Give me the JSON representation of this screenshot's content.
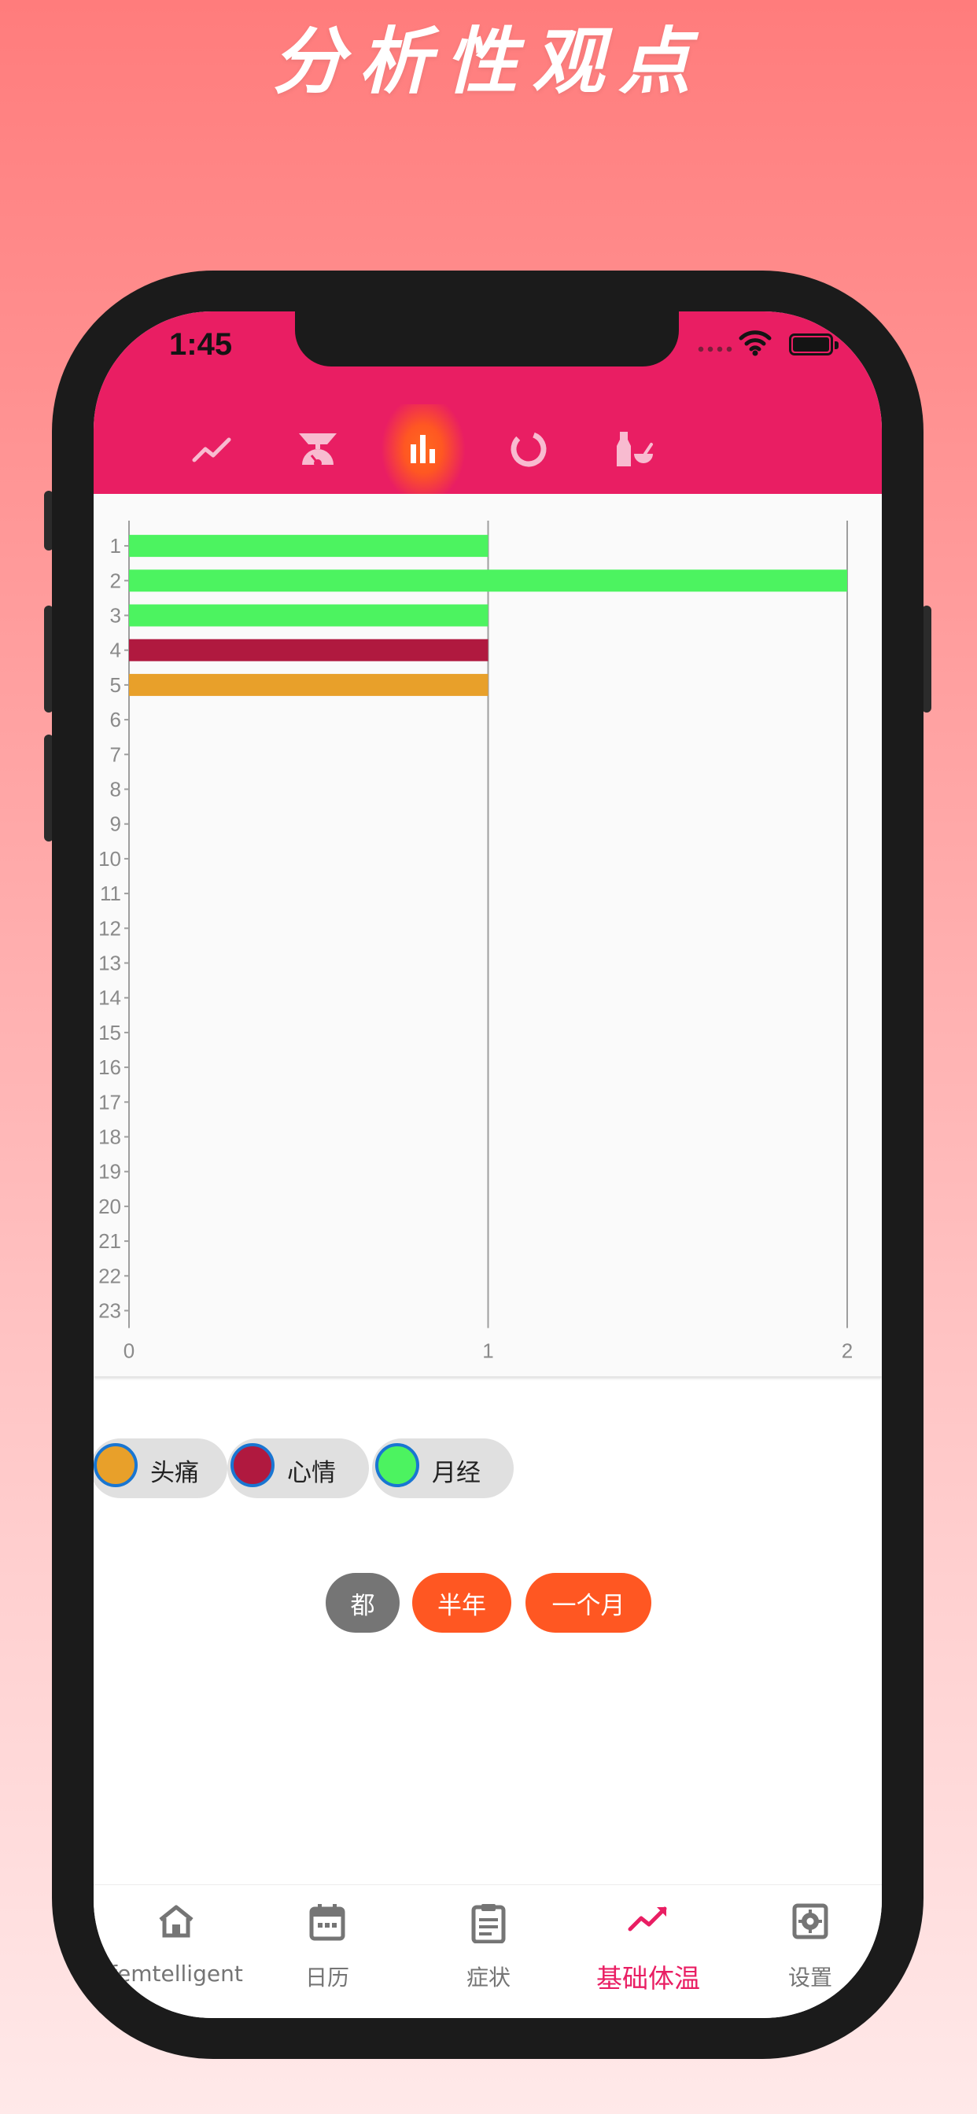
{
  "banner": {
    "title": "分析性观点"
  },
  "status_bar": {
    "time": "1:45"
  },
  "colors": {
    "primary": "#e91e63",
    "accent": "#ff5722",
    "headache": "#e8a02a",
    "mood": "#b0193f",
    "period": "#4cf360",
    "chip_bg": "#e0e0e0",
    "all_button": "#757575"
  },
  "top_tabs": [
    {
      "name": "tab-line-chart",
      "icon": "trending-up-icon",
      "active": false
    },
    {
      "name": "tab-scale",
      "icon": "scale-icon",
      "active": false
    },
    {
      "name": "tab-bar-chart",
      "icon": "bar-chart-icon",
      "active": true
    },
    {
      "name": "tab-donut",
      "icon": "donut-icon",
      "active": false
    },
    {
      "name": "tab-lab",
      "icon": "mortar-bottle-icon",
      "active": false
    }
  ],
  "chart_data": {
    "type": "bar",
    "orientation": "horizontal",
    "categories": [
      "1",
      "2",
      "3",
      "4",
      "5",
      "6",
      "7",
      "8",
      "9",
      "10",
      "11",
      "12",
      "13",
      "14",
      "15",
      "16",
      "17",
      "18",
      "19",
      "20",
      "21",
      "22",
      "23"
    ],
    "values": [
      1,
      2,
      1,
      1,
      1,
      0,
      0,
      0,
      0,
      0,
      0,
      0,
      0,
      0,
      0,
      0,
      0,
      0,
      0,
      0,
      0,
      0,
      0
    ],
    "bar_series": [
      "月经",
      "月经",
      "月经",
      "心情",
      "头痛"
    ],
    "x_ticks": [
      "0",
      "1",
      "2"
    ],
    "xlim": [
      0,
      2
    ],
    "grid": "vertical"
  },
  "legend": [
    {
      "label": "头痛",
      "color": "#e8a02a"
    },
    {
      "label": "心情",
      "color": "#b0193f"
    },
    {
      "label": "月经",
      "color": "#4cf360"
    }
  ],
  "range_buttons": {
    "all": "都",
    "half_year": "半年",
    "one_month": "一个月"
  },
  "bottom_nav": [
    {
      "label": "femtelligent",
      "icon": "home-icon",
      "active": false
    },
    {
      "label": "日历",
      "icon": "calendar-icon",
      "active": false
    },
    {
      "label": "症状",
      "icon": "clipboard-icon",
      "active": false
    },
    {
      "label": "基础体温",
      "icon": "trending-up-icon",
      "active": true
    },
    {
      "label": "设置",
      "icon": "settings-icon",
      "active": false
    }
  ]
}
